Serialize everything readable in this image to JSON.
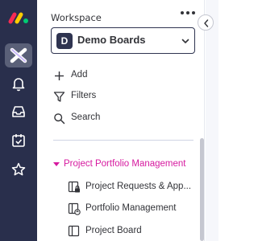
{
  "rail": {
    "items": [
      {
        "icon": "workspace-x-icon"
      },
      {
        "icon": "bell-icon"
      },
      {
        "icon": "inbox-icon"
      },
      {
        "icon": "calendar-check-icon"
      },
      {
        "icon": "star-icon"
      }
    ],
    "colors": {
      "background": "#292f4c",
      "active": "#5a6078"
    }
  },
  "workspace": {
    "label": "Workspace",
    "badge": "D",
    "name": "Demo Boards"
  },
  "actions": [
    {
      "label": "Add",
      "icon": "plus-icon"
    },
    {
      "label": "Filters",
      "icon": "filter-icon"
    },
    {
      "label": "Search",
      "icon": "search-icon"
    }
  ],
  "folder": {
    "label": "Project Portfolio Management",
    "color": "#d6199f"
  },
  "boards": [
    {
      "label": "Project Requests & App...",
      "icon": "board-lock-icon"
    },
    {
      "label": "Portfolio Management",
      "icon": "board-share-icon"
    },
    {
      "label": "Project Board",
      "icon": "board-icon"
    }
  ]
}
